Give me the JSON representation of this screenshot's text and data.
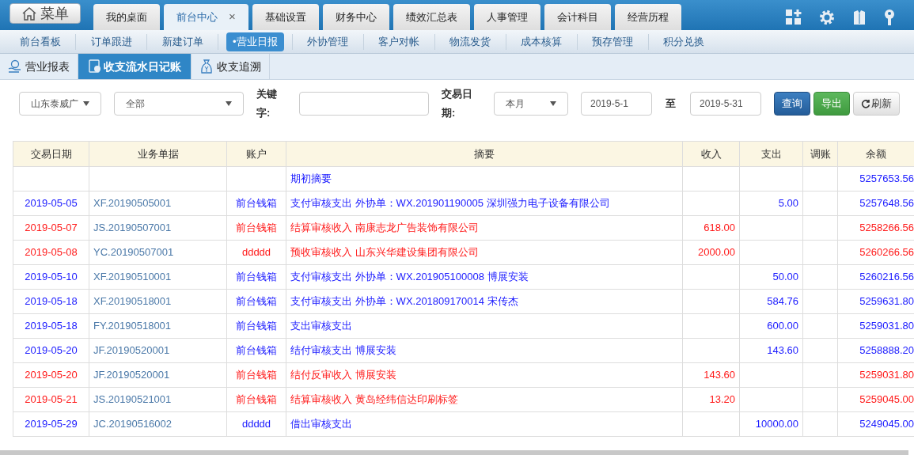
{
  "menu_button": {
    "label": "菜单"
  },
  "tabs": [
    {
      "label": "我的桌面",
      "selected": false
    },
    {
      "label": "前台中心",
      "selected": true,
      "close": "×"
    },
    {
      "label": "基础设置",
      "selected": false
    },
    {
      "label": "财务中心",
      "selected": false
    },
    {
      "label": "绩效汇总表",
      "selected": false
    },
    {
      "label": "人事管理",
      "selected": false
    },
    {
      "label": "会计科目",
      "selected": false
    },
    {
      "label": "经营历程",
      "selected": false
    }
  ],
  "subnav": [
    {
      "label": "前台看板",
      "selected": false
    },
    {
      "label": "订单跟进",
      "selected": false
    },
    {
      "label": "新建订单",
      "selected": false
    },
    {
      "label": "•营业日报",
      "selected": true
    },
    {
      "label": "外协管理",
      "selected": false
    },
    {
      "label": "客户对帐",
      "selected": false
    },
    {
      "label": "物流发货",
      "selected": false
    },
    {
      "label": "成本核算",
      "selected": false
    },
    {
      "label": "预存管理",
      "selected": false
    },
    {
      "label": "积分兑换",
      "selected": false
    }
  ],
  "report_tabs": [
    {
      "label": "营业报表",
      "selected": false
    },
    {
      "label": "收支流水日记账",
      "selected": true
    },
    {
      "label": "收支追溯",
      "selected": false
    }
  ],
  "filters": {
    "store": "山东泰威广",
    "category": "全部",
    "keyword_label": "关键字:",
    "date_label": "交易日期:",
    "period": "本月",
    "date_from": "2019-5-1",
    "to_label": "至",
    "date_to": "2019-5-31",
    "buttons": [
      {
        "label": "查询",
        "kind": "primary"
      },
      {
        "label": "导出",
        "kind": "success"
      },
      {
        "label": "刷新",
        "kind": "refresh"
      }
    ]
  },
  "table": {
    "columns": [
      "交易日期",
      "业务单据",
      "账户",
      "摘要",
      "收入",
      "支出",
      "调账",
      "余额"
    ],
    "rows": [
      {
        "kind": "expense",
        "date": "",
        "doc": "",
        "account": "",
        "summary": "期初摘要",
        "income": "",
        "expense": "",
        "adjust": "",
        "balance": "5257653.56"
      },
      {
        "kind": "expense",
        "date": "2019-05-05",
        "doc": "XF.20190505001",
        "account": "前台钱箱",
        "summary": "支付审核支出 外协单：WX.201901190005 深圳强力电子设备有限公司",
        "income": "",
        "expense": "5.00",
        "adjust": "",
        "balance": "5257648.56"
      },
      {
        "kind": "income",
        "date": "2019-05-07",
        "doc": "JS.20190507001",
        "account": "前台钱箱",
        "summary": "结算审核收入 南康志龙广告装饰有限公司",
        "income": "618.00",
        "expense": "",
        "adjust": "",
        "balance": "5258266.56"
      },
      {
        "kind": "income",
        "date": "2019-05-08",
        "doc": "YC.20190507001",
        "account": "ddddd",
        "summary": "预收审核收入 山东兴华建设集团有限公司",
        "income": "2000.00",
        "expense": "",
        "adjust": "",
        "balance": "5260266.56"
      },
      {
        "kind": "expense",
        "date": "2019-05-10",
        "doc": "XF.20190510001",
        "account": "前台钱箱",
        "summary": "支付审核支出 外协单：WX.201905100008 博展安装",
        "income": "",
        "expense": "50.00",
        "adjust": "",
        "balance": "5260216.56"
      },
      {
        "kind": "expense",
        "date": "2019-05-18",
        "doc": "XF.20190518001",
        "account": "前台钱箱",
        "summary": "支付审核支出 外协单：WX.201809170014 宋传杰",
        "income": "",
        "expense": "584.76",
        "adjust": "",
        "balance": "5259631.80"
      },
      {
        "kind": "expense",
        "date": "2019-05-18",
        "doc": "FY.20190518001",
        "account": "前台钱箱",
        "summary": "支出审核支出",
        "income": "",
        "expense": "600.00",
        "adjust": "",
        "balance": "5259031.80"
      },
      {
        "kind": "expense",
        "date": "2019-05-20",
        "doc": "JF.20190520001",
        "account": "前台钱箱",
        "summary": "结付审核支出 博展安装",
        "income": "",
        "expense": "143.60",
        "adjust": "",
        "balance": "5258888.20"
      },
      {
        "kind": "income",
        "date": "2019-05-20",
        "doc": "JF.20190520001",
        "account": "前台钱箱",
        "summary": "结付反审收入 博展安装",
        "income": "143.60",
        "expense": "",
        "adjust": "",
        "balance": "5259031.80"
      },
      {
        "kind": "income",
        "date": "2019-05-21",
        "doc": "JS.20190521001",
        "account": "前台钱箱",
        "summary": "结算审核收入 黄岛经纬信达印刷标签",
        "income": "13.20",
        "expense": "",
        "adjust": "",
        "balance": "5259045.00"
      },
      {
        "kind": "expense",
        "date": "2019-05-29",
        "doc": "JC.20190516002",
        "account": "ddddd",
        "summary": "借出审核支出",
        "income": "",
        "expense": "10000.00",
        "adjust": "",
        "balance": "5249045.00"
      }
    ]
  }
}
